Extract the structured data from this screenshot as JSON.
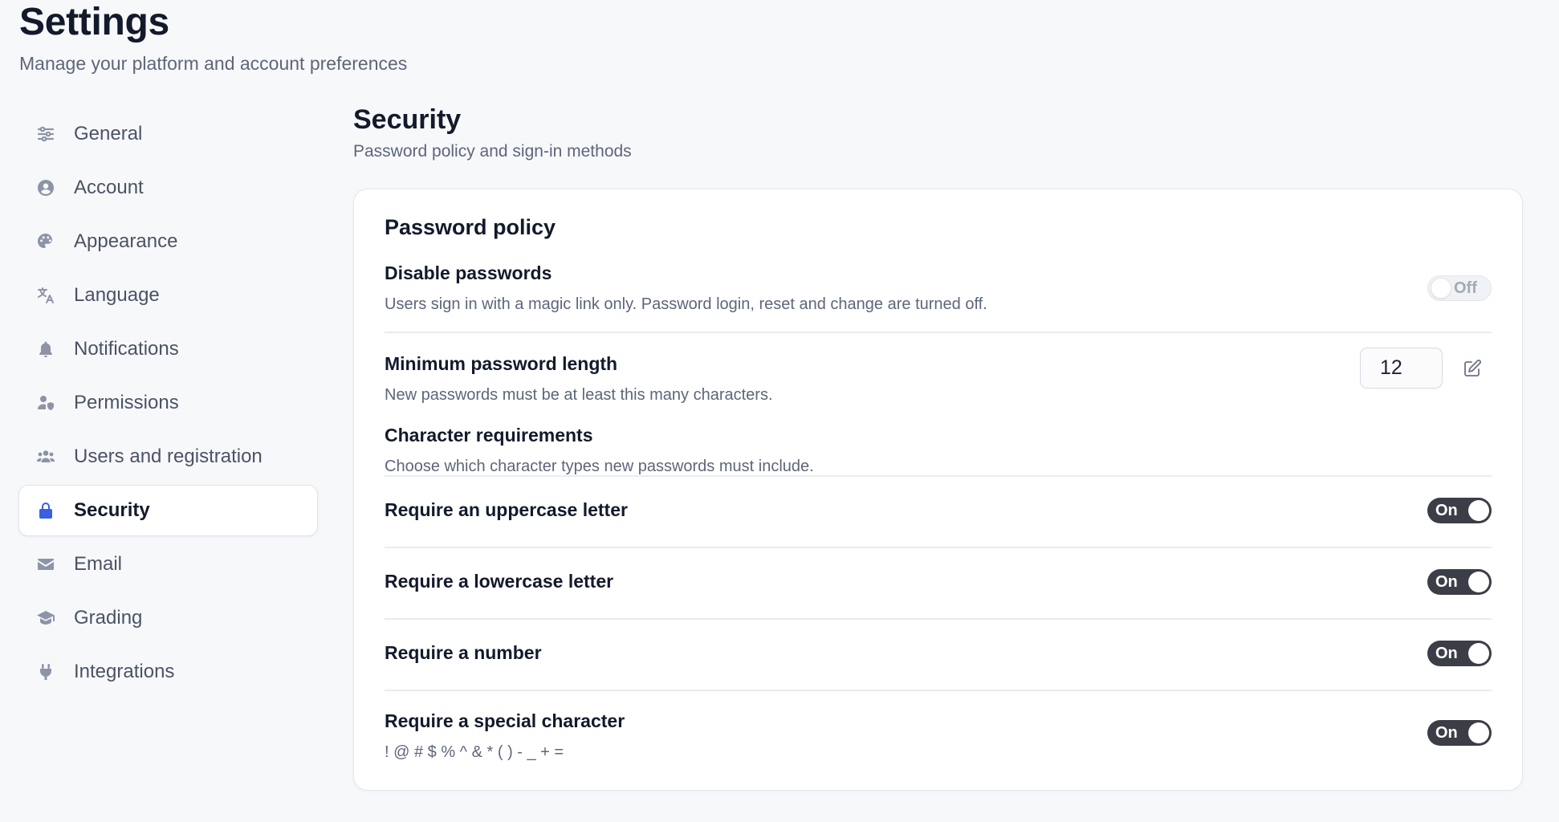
{
  "header": {
    "title": "Settings",
    "subtitle": "Manage your platform and account preferences"
  },
  "sidebar": {
    "items": [
      {
        "label": "General",
        "icon": "sliders-icon"
      },
      {
        "label": "Account",
        "icon": "user-circle-icon"
      },
      {
        "label": "Appearance",
        "icon": "palette-icon"
      },
      {
        "label": "Language",
        "icon": "translate-icon"
      },
      {
        "label": "Notifications",
        "icon": "bell-icon"
      },
      {
        "label": "Permissions",
        "icon": "user-shield-icon"
      },
      {
        "label": "Users and registration",
        "icon": "users-icon"
      },
      {
        "label": "Security",
        "icon": "lock-icon",
        "active": true
      },
      {
        "label": "Email",
        "icon": "envelope-icon"
      },
      {
        "label": "Grading",
        "icon": "graduation-cap-icon"
      },
      {
        "label": "Integrations",
        "icon": "plug-icon"
      }
    ]
  },
  "section": {
    "title": "Security",
    "subtitle": "Password policy and sign-in methods"
  },
  "card": {
    "title": "Password policy",
    "disable_passwords": {
      "label": "Disable passwords",
      "description": "Users sign in with a magic link only. Password login, reset and change are turned off.",
      "toggle": "Off"
    },
    "min_length": {
      "label": "Minimum password length",
      "description": "New passwords must be at least this many characters.",
      "value": "12"
    },
    "char_requirements": {
      "label": "Character requirements",
      "description": "Choose which character types new passwords must include."
    },
    "uppercase": {
      "label": "Require an uppercase letter",
      "toggle": "On"
    },
    "lowercase": {
      "label": "Require a lowercase letter",
      "toggle": "On"
    },
    "number": {
      "label": "Require a number",
      "toggle": "On"
    },
    "special": {
      "label": "Require a special character",
      "description": "! @ # $ % ^ & * ( ) - _ + =",
      "toggle": "On"
    }
  },
  "colors": {
    "accent": "#3a5fe0",
    "toggle_on": "#3b3e47"
  }
}
